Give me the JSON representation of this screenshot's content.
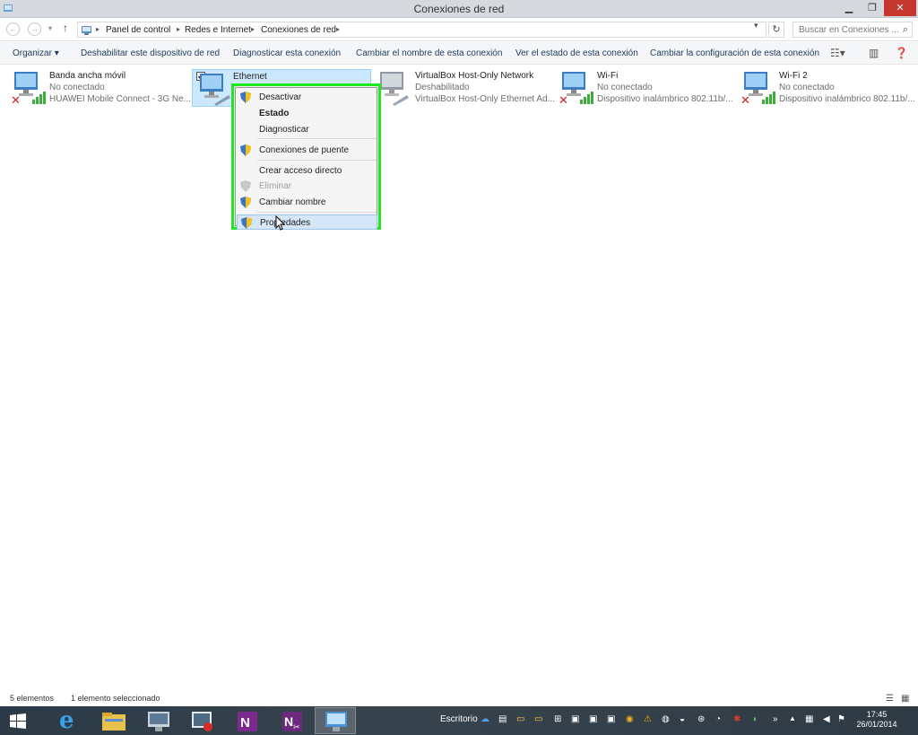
{
  "window": {
    "title": "Conexiones de red",
    "min_icon": "minimize-icon",
    "max_icon": "restore-icon",
    "close_icon": "close-icon"
  },
  "address": {
    "crumbs": [
      "Panel de control",
      "Redes e Internet",
      "Conexiones de red"
    ],
    "search_placeholder": "Buscar en Conexiones ..."
  },
  "toolbar": {
    "organize": "Organizar",
    "disable": "Deshabilitar este dispositivo de red",
    "diagnose": "Diagnosticar esta conexión",
    "rename": "Cambiar el nombre de esta conexión",
    "view_status": "Ver el estado de esta conexión",
    "change_config": "Cambiar la configuración de esta conexión"
  },
  "connections": [
    {
      "name": "Banda ancha móvil",
      "status": "No conectado",
      "device": "HUAWEI Mobile Connect - 3G Ne...",
      "disconnected": true
    },
    {
      "name": "Ethernet",
      "status": "",
      "device": "",
      "selected": true
    },
    {
      "name": "VirtualBox Host-Only Network",
      "status": "Deshabilitado",
      "device": "VirtualBox Host-Only Ethernet Ad...",
      "disconnected": false
    },
    {
      "name": "Wi-Fi",
      "status": "No conectado",
      "device": "Dispositivo inalámbrico 802.11b/...",
      "disconnected": true
    },
    {
      "name": "Wi-Fi 2",
      "status": "No conectado",
      "device": "Dispositivo inalámbrico 802.11b/...",
      "disconnected": true
    }
  ],
  "context_menu": {
    "items": [
      {
        "label": "Desactivar",
        "shield": true
      },
      {
        "label": "Estado",
        "bold": true
      },
      {
        "label": "Diagnosticar"
      },
      {
        "label": "Conexiones de puente",
        "shield": true
      },
      {
        "label": "Crear acceso directo"
      },
      {
        "label": "Eliminar",
        "shield": true,
        "disabled": true
      },
      {
        "label": "Cambiar nombre",
        "shield": true
      },
      {
        "label": "Propiedades",
        "shield": true,
        "highlighted": true
      }
    ],
    "highlight_color": "#1ee81e"
  },
  "statusbar": {
    "count": "5 elementos",
    "selected": "1 elemento seleccionado"
  },
  "taskbar": {
    "desktop_label": "Escritorio",
    "time": "17:45",
    "date": "26/01/2014"
  }
}
